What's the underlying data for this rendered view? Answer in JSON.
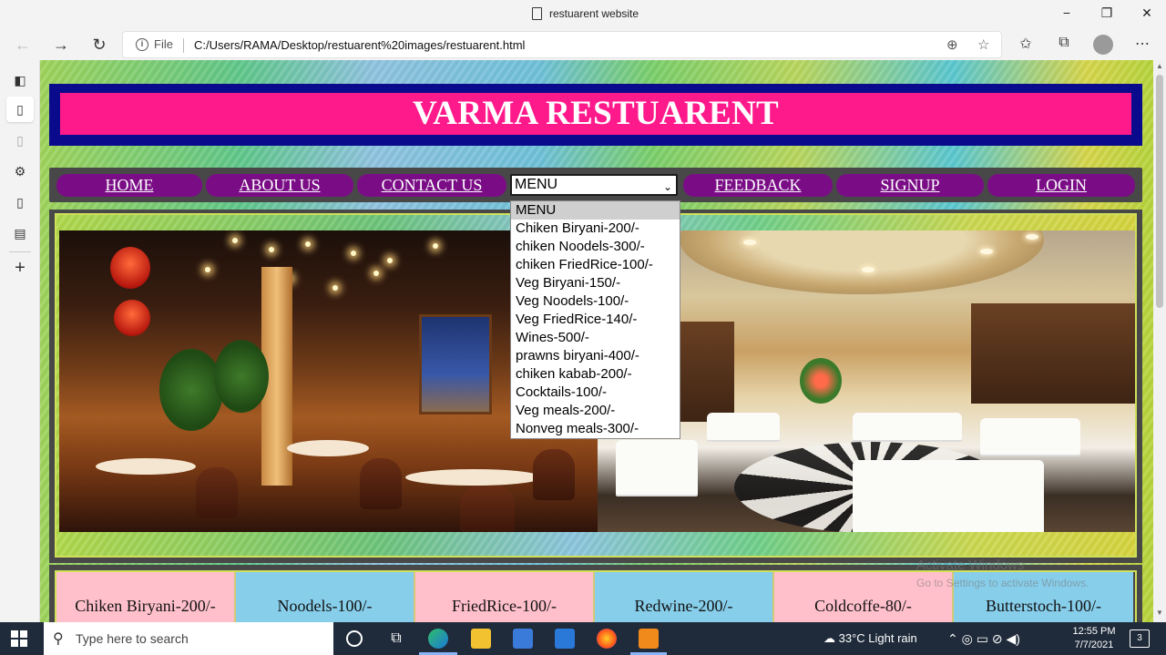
{
  "browser": {
    "tab_title": "restuarent website",
    "window_controls": {
      "minimize": "−",
      "maximize": "❐",
      "close": "✕"
    },
    "nav": {
      "back": "←",
      "forward": "→",
      "refresh": "↻"
    },
    "address": {
      "protocol_label": "File",
      "url": "C:/Users/RAMA/Desktop/restuarent%20images/restuarent.html"
    },
    "more": "⋯"
  },
  "page": {
    "heading": "VARMA RESTUARENT",
    "nav_links": [
      "HOME",
      "ABOUT US",
      "CONTACT US",
      "FEEDBACK",
      "SIGNUP",
      "LOGIN"
    ],
    "menu_select": {
      "selected": "MENU",
      "options": [
        "MENU",
        "Chiken Biryani-200/-",
        "chiken Noodels-300/-",
        "chiken FriedRice-100/-",
        "Veg Biryani-150/-",
        "Veg Noodels-100/-",
        "Veg FriedRice-140/-",
        "Wines-500/-",
        "prawns biryani-400/-",
        "chiken kabab-200/-",
        "Cocktails-100/-",
        "Veg meals-200/-",
        "Nonveg meals-300/-"
      ]
    },
    "cards": [
      {
        "label": "Chiken Biryani-200/-",
        "color": "#ffc0cb"
      },
      {
        "label": "Noodels-100/-",
        "color": "#87ceeb"
      },
      {
        "label": "FriedRice-100/-",
        "color": "#ffc0cb"
      },
      {
        "label": "Redwine-200/-",
        "color": "#87ceeb"
      },
      {
        "label": "Coldcoffe-80/-",
        "color": "#ffc0cb"
      },
      {
        "label": "Butterstoch-100/-",
        "color": "#87ceeb"
      }
    ],
    "colors": {
      "header_bg": "#ff1a8c",
      "header_border": "#0a0a8c",
      "menu_item": "#7a0d86"
    }
  },
  "watermark": {
    "line1": "Activate Windows",
    "line2": "Go to Settings to activate Windows."
  },
  "taskbar": {
    "search_placeholder": "Type here to search",
    "weather": "33°C  Light rain",
    "time": "12:55 PM",
    "date": "7/7/2021",
    "notifications": "3"
  }
}
